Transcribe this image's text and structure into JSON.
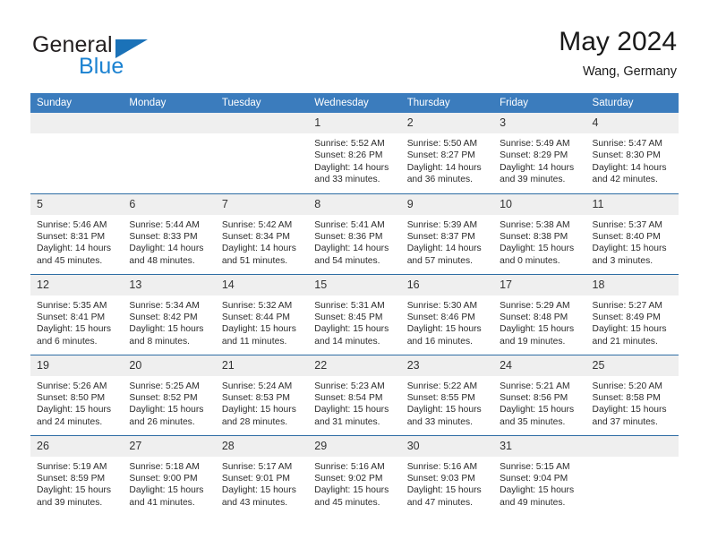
{
  "brand": {
    "name_primary": "General",
    "name_secondary": "Blue",
    "triangle_color": "#1b72b8",
    "secondary_color": "#1b82d1"
  },
  "header": {
    "title": "May 2024",
    "subtitle": "Wang, Germany"
  },
  "theme": {
    "header_row_color": "#3b7cbd",
    "row_divider_color": "#2e6da4",
    "date_band_color": "#efefef",
    "text_color": "#2b2b2b"
  },
  "calendar": {
    "weekday_headers": [
      "Sunday",
      "Monday",
      "Tuesday",
      "Wednesday",
      "Thursday",
      "Friday",
      "Saturday"
    ],
    "labels": {
      "sunrise": "Sunrise:",
      "sunset": "Sunset:",
      "daylight": "Daylight:"
    },
    "weeks": [
      [
        {
          "day": "",
          "empty": true
        },
        {
          "day": "",
          "empty": true
        },
        {
          "day": "",
          "empty": true
        },
        {
          "day": "1",
          "sunrise": "Sunrise: 5:52 AM",
          "sunset": "Sunset: 8:26 PM",
          "daylight_1": "Daylight: 14 hours",
          "daylight_2": "and 33 minutes."
        },
        {
          "day": "2",
          "sunrise": "Sunrise: 5:50 AM",
          "sunset": "Sunset: 8:27 PM",
          "daylight_1": "Daylight: 14 hours",
          "daylight_2": "and 36 minutes."
        },
        {
          "day": "3",
          "sunrise": "Sunrise: 5:49 AM",
          "sunset": "Sunset: 8:29 PM",
          "daylight_1": "Daylight: 14 hours",
          "daylight_2": "and 39 minutes."
        },
        {
          "day": "4",
          "sunrise": "Sunrise: 5:47 AM",
          "sunset": "Sunset: 8:30 PM",
          "daylight_1": "Daylight: 14 hours",
          "daylight_2": "and 42 minutes."
        }
      ],
      [
        {
          "day": "5",
          "sunrise": "Sunrise: 5:46 AM",
          "sunset": "Sunset: 8:31 PM",
          "daylight_1": "Daylight: 14 hours",
          "daylight_2": "and 45 minutes."
        },
        {
          "day": "6",
          "sunrise": "Sunrise: 5:44 AM",
          "sunset": "Sunset: 8:33 PM",
          "daylight_1": "Daylight: 14 hours",
          "daylight_2": "and 48 minutes."
        },
        {
          "day": "7",
          "sunrise": "Sunrise: 5:42 AM",
          "sunset": "Sunset: 8:34 PM",
          "daylight_1": "Daylight: 14 hours",
          "daylight_2": "and 51 minutes."
        },
        {
          "day": "8",
          "sunrise": "Sunrise: 5:41 AM",
          "sunset": "Sunset: 8:36 PM",
          "daylight_1": "Daylight: 14 hours",
          "daylight_2": "and 54 minutes."
        },
        {
          "day": "9",
          "sunrise": "Sunrise: 5:39 AM",
          "sunset": "Sunset: 8:37 PM",
          "daylight_1": "Daylight: 14 hours",
          "daylight_2": "and 57 minutes."
        },
        {
          "day": "10",
          "sunrise": "Sunrise: 5:38 AM",
          "sunset": "Sunset: 8:38 PM",
          "daylight_1": "Daylight: 15 hours",
          "daylight_2": "and 0 minutes."
        },
        {
          "day": "11",
          "sunrise": "Sunrise: 5:37 AM",
          "sunset": "Sunset: 8:40 PM",
          "daylight_1": "Daylight: 15 hours",
          "daylight_2": "and 3 minutes."
        }
      ],
      [
        {
          "day": "12",
          "sunrise": "Sunrise: 5:35 AM",
          "sunset": "Sunset: 8:41 PM",
          "daylight_1": "Daylight: 15 hours",
          "daylight_2": "and 6 minutes."
        },
        {
          "day": "13",
          "sunrise": "Sunrise: 5:34 AM",
          "sunset": "Sunset: 8:42 PM",
          "daylight_1": "Daylight: 15 hours",
          "daylight_2": "and 8 minutes."
        },
        {
          "day": "14",
          "sunrise": "Sunrise: 5:32 AM",
          "sunset": "Sunset: 8:44 PM",
          "daylight_1": "Daylight: 15 hours",
          "daylight_2": "and 11 minutes."
        },
        {
          "day": "15",
          "sunrise": "Sunrise: 5:31 AM",
          "sunset": "Sunset: 8:45 PM",
          "daylight_1": "Daylight: 15 hours",
          "daylight_2": "and 14 minutes."
        },
        {
          "day": "16",
          "sunrise": "Sunrise: 5:30 AM",
          "sunset": "Sunset: 8:46 PM",
          "daylight_1": "Daylight: 15 hours",
          "daylight_2": "and 16 minutes."
        },
        {
          "day": "17",
          "sunrise": "Sunrise: 5:29 AM",
          "sunset": "Sunset: 8:48 PM",
          "daylight_1": "Daylight: 15 hours",
          "daylight_2": "and 19 minutes."
        },
        {
          "day": "18",
          "sunrise": "Sunrise: 5:27 AM",
          "sunset": "Sunset: 8:49 PM",
          "daylight_1": "Daylight: 15 hours",
          "daylight_2": "and 21 minutes."
        }
      ],
      [
        {
          "day": "19",
          "sunrise": "Sunrise: 5:26 AM",
          "sunset": "Sunset: 8:50 PM",
          "daylight_1": "Daylight: 15 hours",
          "daylight_2": "and 24 minutes."
        },
        {
          "day": "20",
          "sunrise": "Sunrise: 5:25 AM",
          "sunset": "Sunset: 8:52 PM",
          "daylight_1": "Daylight: 15 hours",
          "daylight_2": "and 26 minutes."
        },
        {
          "day": "21",
          "sunrise": "Sunrise: 5:24 AM",
          "sunset": "Sunset: 8:53 PM",
          "daylight_1": "Daylight: 15 hours",
          "daylight_2": "and 28 minutes."
        },
        {
          "day": "22",
          "sunrise": "Sunrise: 5:23 AM",
          "sunset": "Sunset: 8:54 PM",
          "daylight_1": "Daylight: 15 hours",
          "daylight_2": "and 31 minutes."
        },
        {
          "day": "23",
          "sunrise": "Sunrise: 5:22 AM",
          "sunset": "Sunset: 8:55 PM",
          "daylight_1": "Daylight: 15 hours",
          "daylight_2": "and 33 minutes."
        },
        {
          "day": "24",
          "sunrise": "Sunrise: 5:21 AM",
          "sunset": "Sunset: 8:56 PM",
          "daylight_1": "Daylight: 15 hours",
          "daylight_2": "and 35 minutes."
        },
        {
          "day": "25",
          "sunrise": "Sunrise: 5:20 AM",
          "sunset": "Sunset: 8:58 PM",
          "daylight_1": "Daylight: 15 hours",
          "daylight_2": "and 37 minutes."
        }
      ],
      [
        {
          "day": "26",
          "sunrise": "Sunrise: 5:19 AM",
          "sunset": "Sunset: 8:59 PM",
          "daylight_1": "Daylight: 15 hours",
          "daylight_2": "and 39 minutes."
        },
        {
          "day": "27",
          "sunrise": "Sunrise: 5:18 AM",
          "sunset": "Sunset: 9:00 PM",
          "daylight_1": "Daylight: 15 hours",
          "daylight_2": "and 41 minutes."
        },
        {
          "day": "28",
          "sunrise": "Sunrise: 5:17 AM",
          "sunset": "Sunset: 9:01 PM",
          "daylight_1": "Daylight: 15 hours",
          "daylight_2": "and 43 minutes."
        },
        {
          "day": "29",
          "sunrise": "Sunrise: 5:16 AM",
          "sunset": "Sunset: 9:02 PM",
          "daylight_1": "Daylight: 15 hours",
          "daylight_2": "and 45 minutes."
        },
        {
          "day": "30",
          "sunrise": "Sunrise: 5:16 AM",
          "sunset": "Sunset: 9:03 PM",
          "daylight_1": "Daylight: 15 hours",
          "daylight_2": "and 47 minutes."
        },
        {
          "day": "31",
          "sunrise": "Sunrise: 5:15 AM",
          "sunset": "Sunset: 9:04 PM",
          "daylight_1": "Daylight: 15 hours",
          "daylight_2": "and 49 minutes."
        },
        {
          "day": "",
          "empty": true
        }
      ]
    ]
  }
}
